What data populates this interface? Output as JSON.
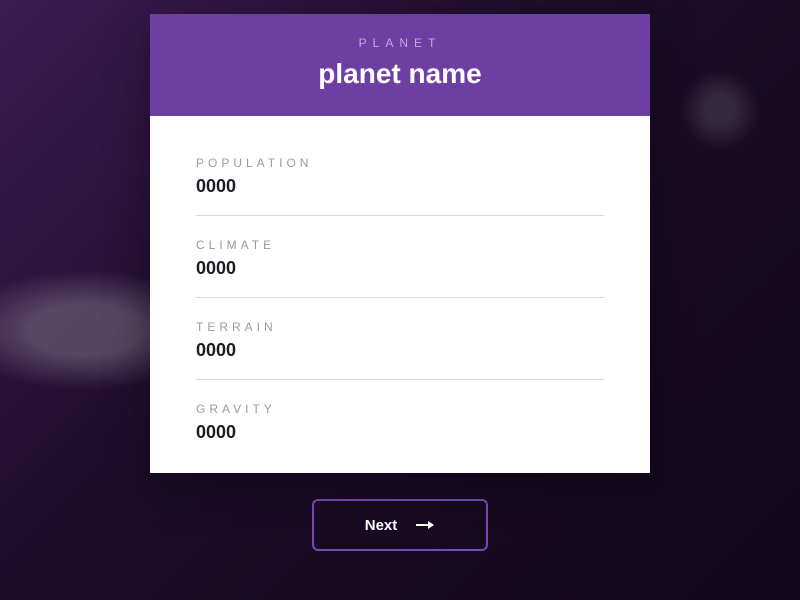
{
  "header": {
    "eyebrow": "PLANET",
    "title": "planet name"
  },
  "fields": [
    {
      "label": "POPULATION",
      "value": "0000"
    },
    {
      "label": "CLIMATE",
      "value": "0000"
    },
    {
      "label": "TERRAIN",
      "value": "0000"
    },
    {
      "label": "GRAVITY",
      "value": "0000"
    }
  ],
  "nav": {
    "next_label": "Next"
  }
}
